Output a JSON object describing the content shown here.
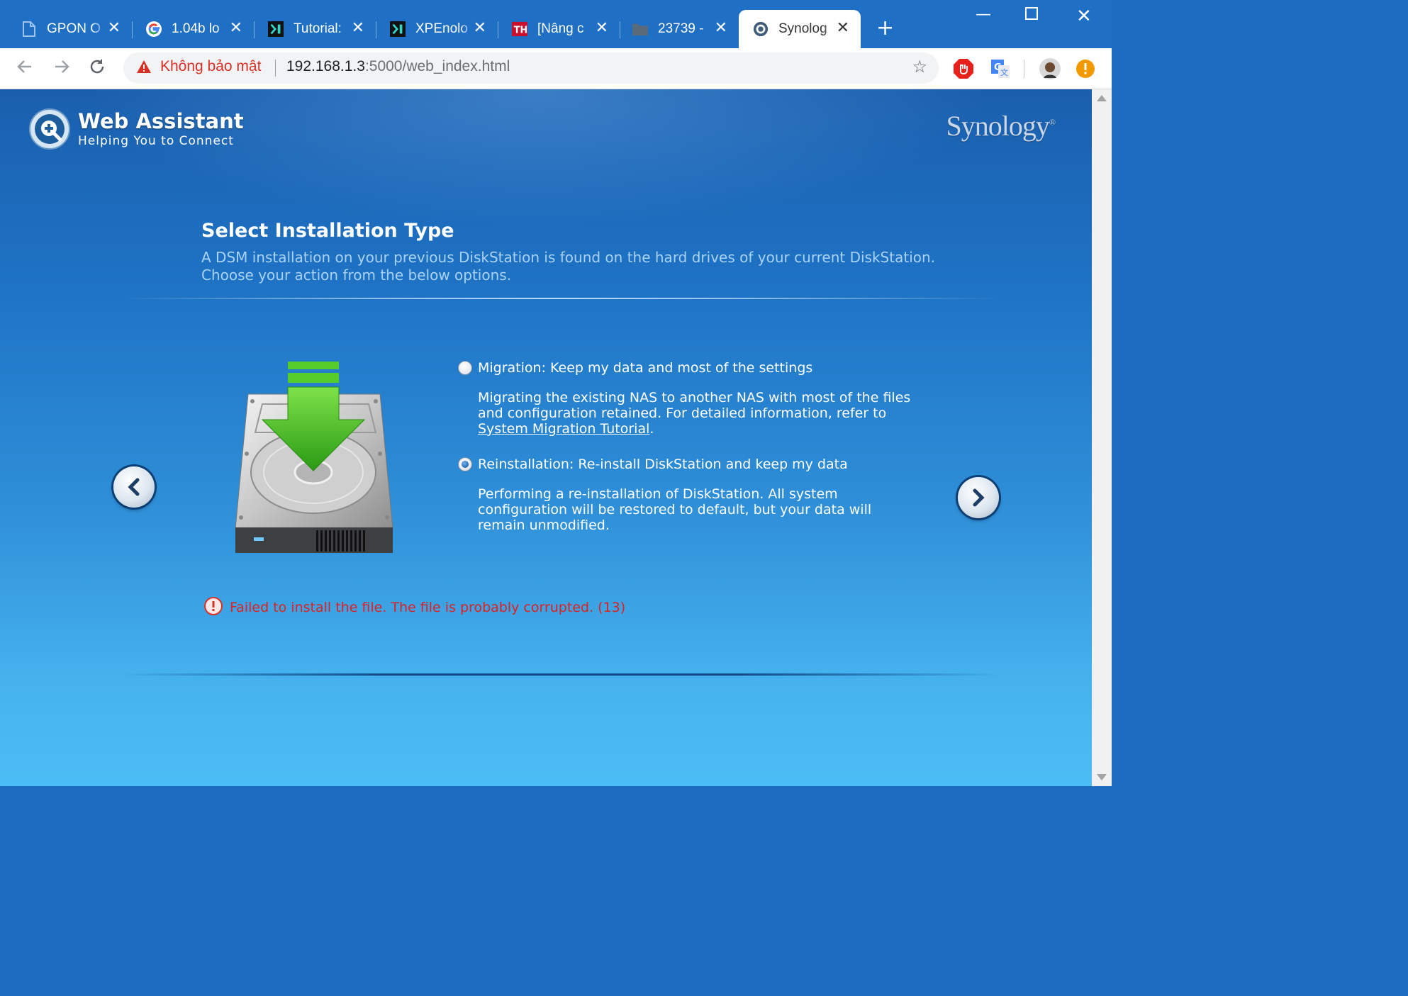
{
  "tabs": [
    {
      "title": "GPON O",
      "icon": "document-icon"
    },
    {
      "title": "1.04b lo",
      "icon": "google-icon"
    },
    {
      "title": "Tutorial:",
      "icon": "xpenology-icon"
    },
    {
      "title": "XPEnolo",
      "icon": "xpenology-icon"
    },
    {
      "title": "[Nâng c",
      "icon": "forum-icon"
    },
    {
      "title": "23739 -",
      "icon": "folder-icon"
    },
    {
      "title": "Synolog",
      "icon": "synology-icon",
      "active": true
    }
  ],
  "toolbar": {
    "security_label": "Không bảo mật",
    "url_host": "192.168.1.3",
    "url_rest": ":5000/web_index.html"
  },
  "header": {
    "app_title": "Web Assistant",
    "app_subtitle": "Helping You to Connect",
    "brand": "Synology"
  },
  "main": {
    "heading": "Select Installation Type",
    "description": "A DSM installation on your previous DiskStation is found on the hard drives of your current DiskStation. Choose your action from the below options.",
    "options": [
      {
        "label": "Migration: Keep my data and most of the settings",
        "desc_pre": "Migrating the existing NAS to another NAS with most of the files and configuration retained. For detailed information, refer to ",
        "link": "System Migration Tutorial",
        "desc_post": ".",
        "checked": false
      },
      {
        "label": "Reinstallation: Re-install DiskStation and keep my data",
        "desc": "Performing a re-installation of DiskStation. All system configuration will be restored to default, but your data will remain unmodified.",
        "checked": true
      }
    ],
    "error": "Failed to install the file. The file is probably corrupted. (13)"
  },
  "colors": {
    "tabbar": "#1f6fc5",
    "error": "#e02020",
    "accent": "#0b4c96"
  }
}
